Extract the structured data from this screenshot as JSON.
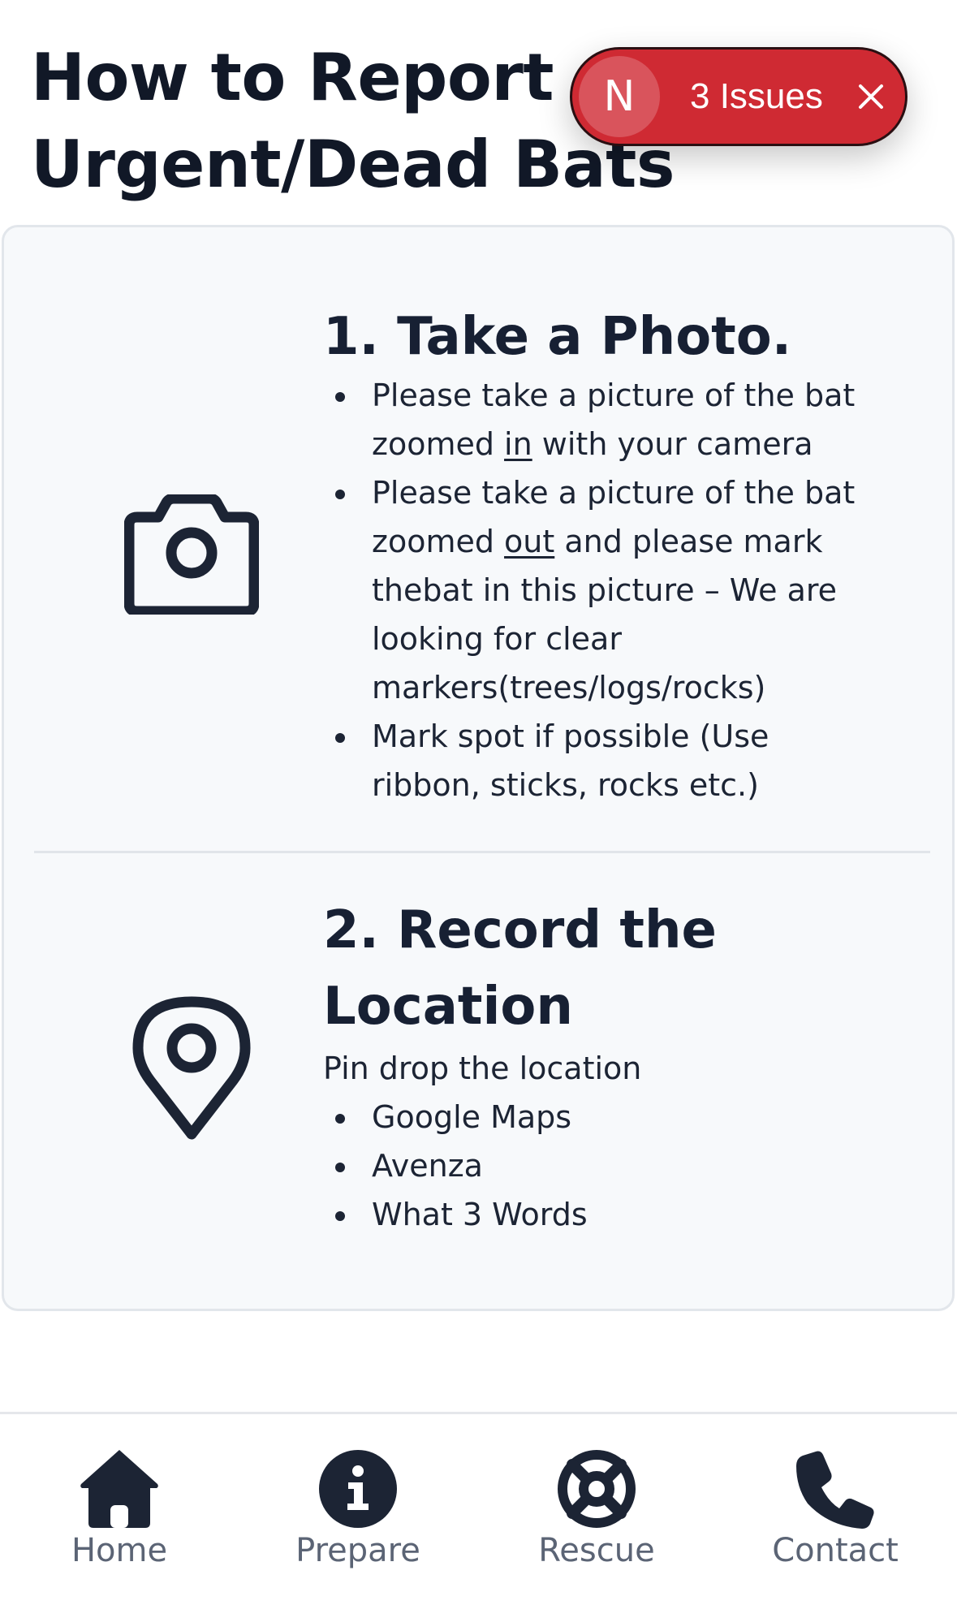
{
  "page": {
    "title_line1": "How to Report",
    "title_line2": "Urgent/Dead Bats"
  },
  "issues_badge": {
    "letter": "N",
    "label": "3 Issues",
    "color": "#cf2a33"
  },
  "steps": [
    {
      "icon": "camera-icon",
      "title": "1. Take a Photo.",
      "bullets": [
        {
          "line1_pre": "Please take a picture of the bat",
          "line2_pre": "zoomed ",
          "emph": "in",
          "line2_post": " with your camera"
        },
        {
          "line1_pre": "Please take a picture of the bat",
          "line2_pre": "zoomed ",
          "emph": "out",
          "line2_post": " and please mark",
          "line3": "thebat in this picture – We are",
          "line4": "looking for clear",
          "line5": "markers(trees/logs/rocks)"
        },
        {
          "line1": "Mark spot if possible (Use",
          "line2": "ribbon, sticks, rocks etc.)"
        }
      ]
    },
    {
      "icon": "map-pin-icon",
      "title_line1": "2. Record the",
      "title_line2": "Location",
      "intro": "Pin drop the location",
      "bullets": [
        "Google Maps",
        "Avenza",
        "What 3 Words"
      ]
    }
  ],
  "nav": [
    {
      "label": "Home",
      "icon": "home-icon"
    },
    {
      "label": "Prepare",
      "icon": "info-icon"
    },
    {
      "label": "Rescue",
      "icon": "lifebuoy-icon"
    },
    {
      "label": "Contact",
      "icon": "phone-icon"
    }
  ],
  "colors": {
    "text_dark": "#172033",
    "card_bg": "#f7f9fb",
    "nav_label": "#5b6475"
  }
}
